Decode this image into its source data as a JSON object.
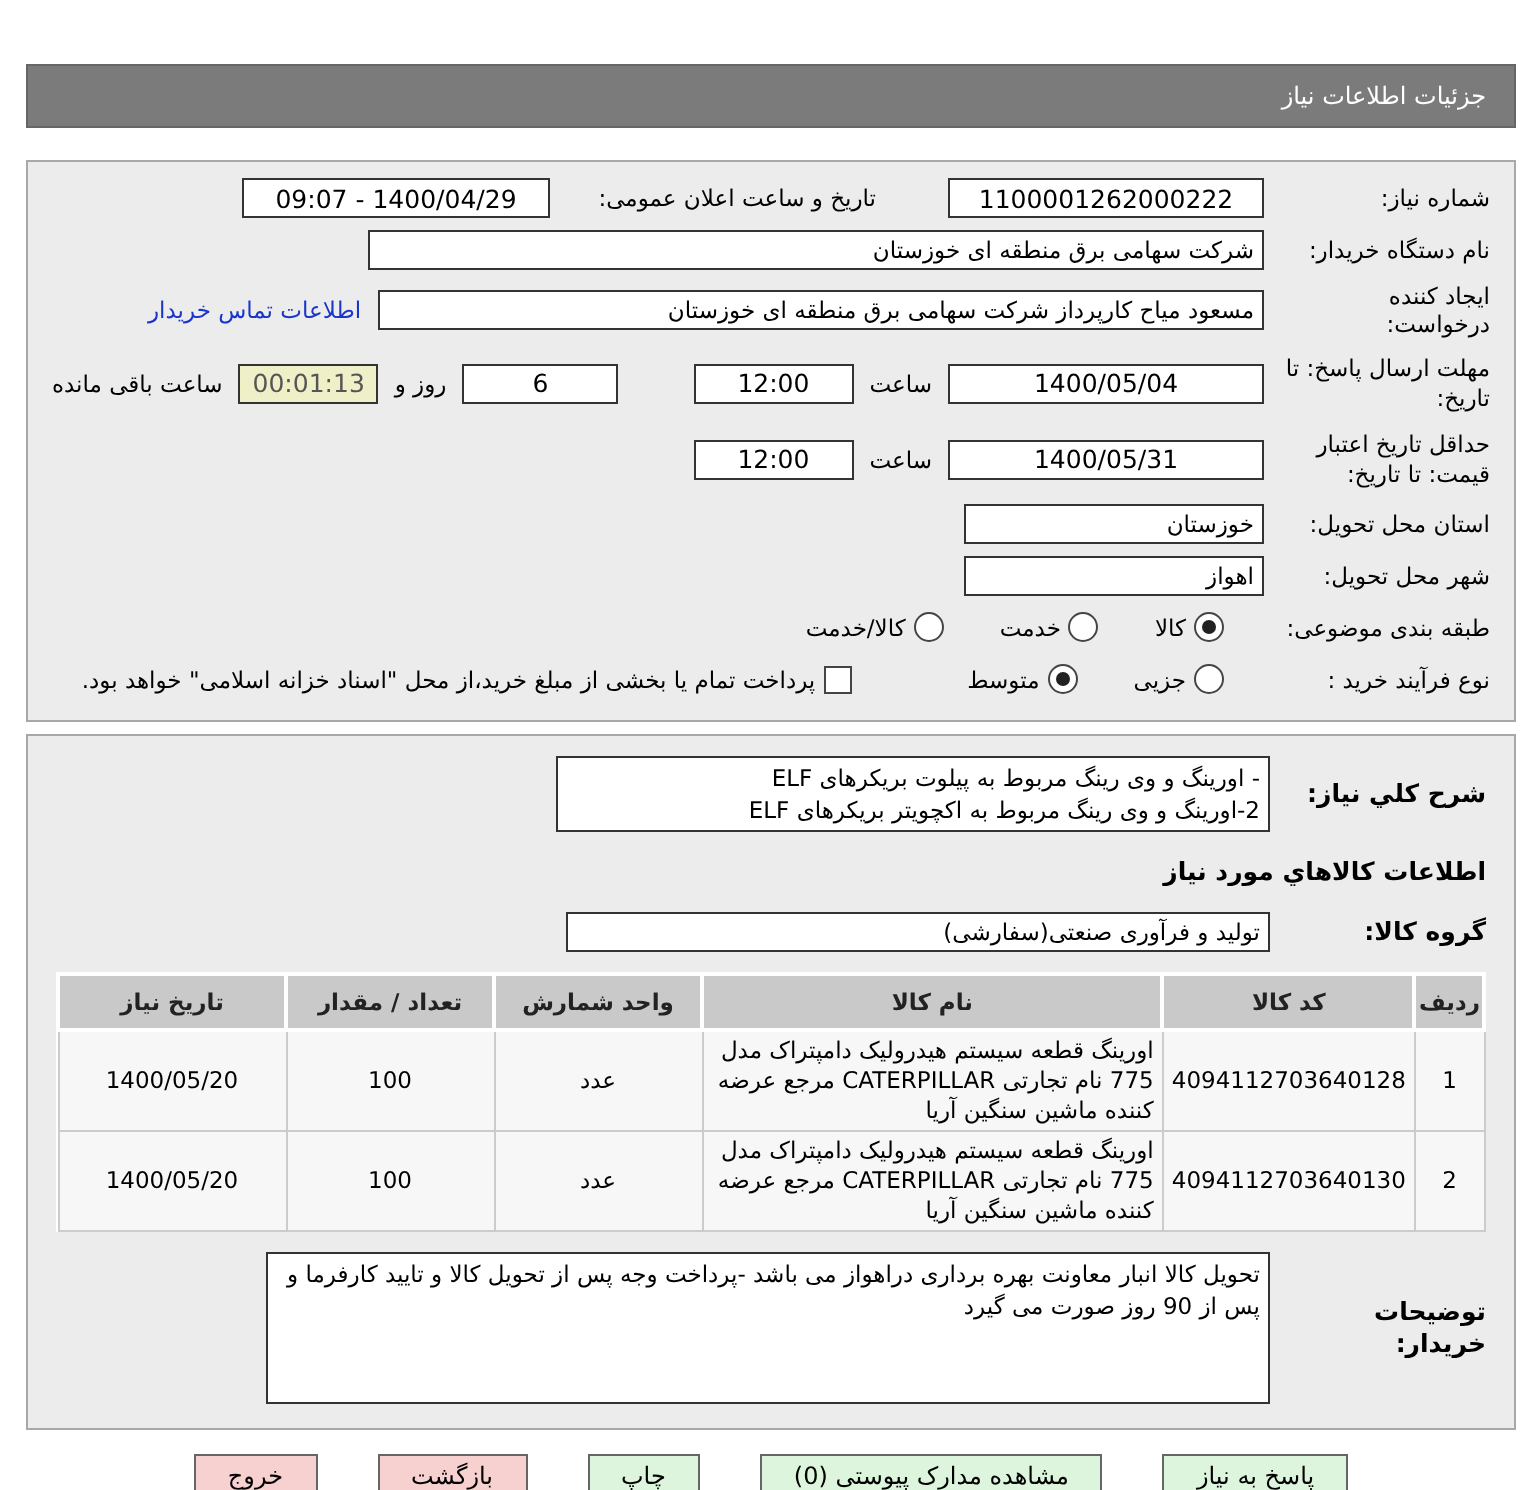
{
  "header": {
    "title": "جزئیات اطلاعات نیاز"
  },
  "need_number": {
    "label": "شماره نیاز:",
    "value": "1100001262000222"
  },
  "announce": {
    "label": "تاریخ و ساعت اعلان عمومی:",
    "value": "1400/04/29 - 09:07"
  },
  "buyer_org": {
    "label": "نام دستگاه خریدار:",
    "value": "شرکت سهامی برق منطقه ای خوزستان"
  },
  "creator": {
    "label": "ایجاد کننده درخواست:",
    "value": "مسعود میاح کارپرداز شرکت سهامی برق منطقه ای خوزستان",
    "link": "اطلاعات تماس خریدار"
  },
  "deadline": {
    "label": "مهلت ارسال پاسخ: تا تاریخ:",
    "date": "1400/05/04",
    "time_label": "ساعت",
    "time": "12:00",
    "days": "6",
    "days_label": "روز و",
    "remaining": "00:01:13",
    "remaining_label": "ساعت باقی مانده"
  },
  "validity": {
    "label": "حداقل تاریخ اعتبار قیمت: تا تاریخ:",
    "date": "1400/05/31",
    "time_label": "ساعت",
    "time": "12:00"
  },
  "province": {
    "label": "استان محل تحویل:",
    "value": "خوزستان"
  },
  "city": {
    "label": "شهر محل تحویل:",
    "value": "اهواز"
  },
  "category": {
    "label": "طبقه بندی موضوعی:",
    "options": [
      {
        "label": "کالا",
        "selected": true
      },
      {
        "label": "خدمت",
        "selected": false
      },
      {
        "label": "کالا/خدمت",
        "selected": false
      }
    ]
  },
  "process": {
    "label": "نوع فرآیند خرید :",
    "options": [
      {
        "label": "جزیی",
        "selected": false
      },
      {
        "label": "متوسط",
        "selected": true
      }
    ],
    "payment": {
      "label": "پرداخت تمام یا بخشی از مبلغ خرید،از محل \"اسناد خزانه اسلامی\" خواهد بود.",
      "checked": false
    }
  },
  "description": {
    "label": "شرح کلي نياز:",
    "lines": [
      "- اورینگ و وی رینگ مربوط به پیلوت بریکرهای ELF",
      "2-اورینگ و وی رینگ مربوط به اکچویتر بریکرهای ELF"
    ]
  },
  "goods_heading": "اطلاعات کالاهاي مورد نياز",
  "goods_group": {
    "label": "گروه کالا:",
    "value": "تولید و فرآوری صنعتی(سفارشی)"
  },
  "table": {
    "columns": [
      "ردیف",
      "کد کالا",
      "نام کالا",
      "واحد شمارش",
      "تعداد / مقدار",
      "تاریخ نیاز"
    ],
    "rows": [
      [
        "1",
        "4094112703640128",
        "اورینگ قطعه سیستم هیدرولیک دامپتراک مدل 775 نام تجارتی CATERPILLAR مرجع عرضه کننده ماشین سنگین آریا",
        "عدد",
        "100",
        "1400/05/20"
      ],
      [
        "2",
        "4094112703640130",
        "اورینگ قطعه سیستم هیدرولیک دامپتراک مدل 775 نام تجارتی CATERPILLAR مرجع عرضه کننده ماشین سنگین آریا",
        "عدد",
        "100",
        "1400/05/20"
      ]
    ]
  },
  "buyer_notes": {
    "label": "توضیحات خریدار:",
    "value": "تحویل کالا انبار معاونت بهره برداری دراهواز می باشد -پرداخت وجه پس از تحویل کالا و تایید کارفرما و پس از 90 روز صورت می گیرد"
  },
  "buttons": [
    {
      "label": "پاسخ به نیاز",
      "kind": "green"
    },
    {
      "label": "مشاهده مدارک پیوستی (0)",
      "kind": "green"
    },
    {
      "label": "چاپ",
      "kind": "green"
    },
    {
      "label": "بازگشت",
      "kind": "red"
    },
    {
      "label": "خروج",
      "kind": "red"
    }
  ]
}
